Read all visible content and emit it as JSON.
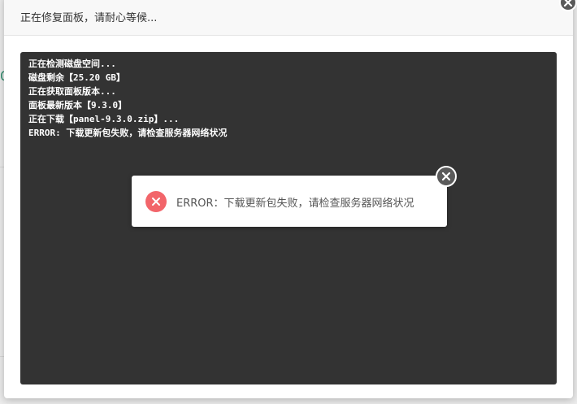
{
  "modal": {
    "title": "正在修复面板，请耐心等候..."
  },
  "background": {
    "visible_char": "0"
  },
  "console": {
    "lines": [
      "正在检测磁盘空间...",
      "磁盘剩余【25.20 GB】",
      "正在获取面板版本...",
      "面板最新版本【9.3.0】",
      "正在下载【panel-9.3.0.zip】...",
      "ERROR: 下载更新包失败，请检查服务器网络状况"
    ]
  },
  "toast": {
    "message": "ERROR：下载更新包失败，请检查服务器网络状况",
    "icon": "error-circle-icon",
    "close_icon": "close-circle-icon"
  },
  "colors": {
    "console_bg": "#333333",
    "error_red": "#f2656a",
    "close_gray": "#5a5a5a"
  }
}
